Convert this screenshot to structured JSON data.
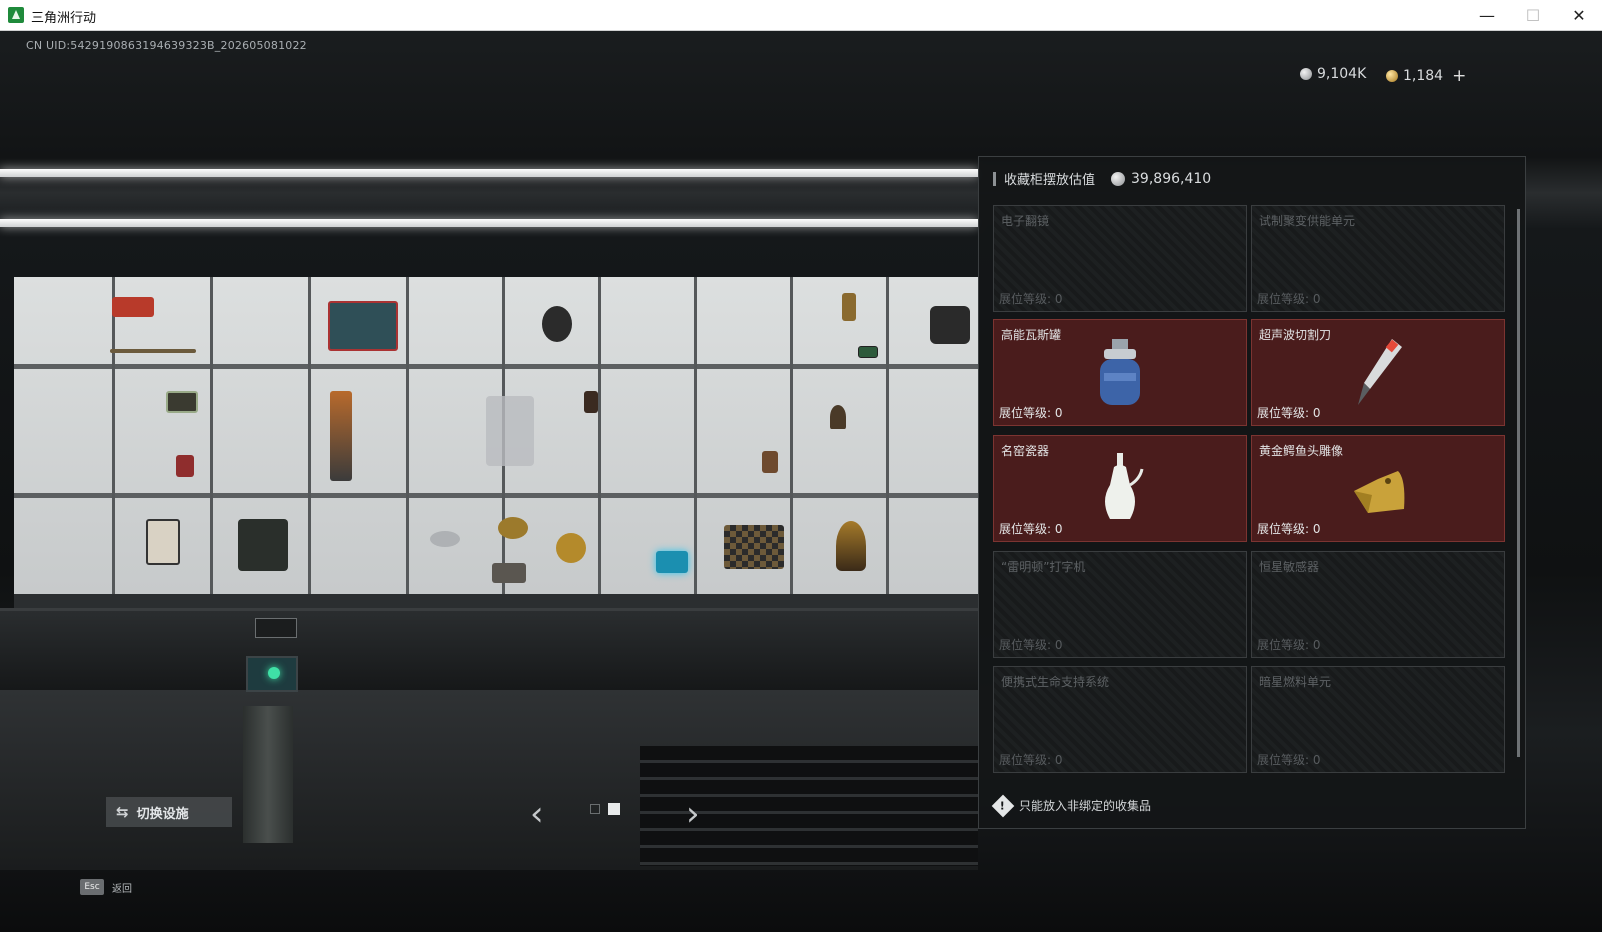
{
  "window": {
    "title": "三角洲行动",
    "minimize": "—",
    "maximize": "☐",
    "close": "✕"
  },
  "hud": {
    "uid": "CN UID:5429190863194639323B_202605081022",
    "currencies": [
      {
        "icon": "silver-coin-icon",
        "value": "9,104K"
      },
      {
        "icon": "gold-coin-icon",
        "value": "1,184"
      }
    ],
    "plus": "+"
  },
  "bottom": {
    "switch_label": "切换设施",
    "switch_icon": "⇆",
    "esc_key": "Esc",
    "esc_label": "返回",
    "prev": "‹",
    "next": "›",
    "pages": 2,
    "active_page": 2
  },
  "panel": {
    "title": "收藏柜摆放估值",
    "value": "39,896,410",
    "note": "只能放入非绑定的收集品",
    "level_label": "展位等级: ",
    "slots": [
      {
        "name": "电子翻镜",
        "level": "0",
        "filled": false
      },
      {
        "name": "试制聚变供能单元",
        "level": "0",
        "filled": false
      },
      {
        "name": "高能瓦斯罐",
        "level": "0",
        "filled": true,
        "icon": "gas-canister-icon"
      },
      {
        "name": "超声波切割刀",
        "level": "0",
        "filled": true,
        "icon": "ultrasonic-cutter-icon"
      },
      {
        "name": "名窑瓷器",
        "level": "0",
        "filled": true,
        "icon": "porcelain-vase-icon"
      },
      {
        "name": "黄金鳄鱼头雕像",
        "level": "0",
        "filled": true,
        "icon": "gold-crocodile-icon"
      },
      {
        "name": "“雷明顿”打字机",
        "level": "0",
        "filled": false
      },
      {
        "name": "恒星敏感器",
        "level": "0",
        "filled": false
      },
      {
        "name": "便携式生命支持系统",
        "level": "0",
        "filled": false
      },
      {
        "name": "暗星燃料单元",
        "level": "0",
        "filled": false
      }
    ]
  },
  "colors": {
    "filled_slot": "#4a1c1c",
    "empty_slot": "#1d2021",
    "accent_green": "#3fe0a6"
  }
}
